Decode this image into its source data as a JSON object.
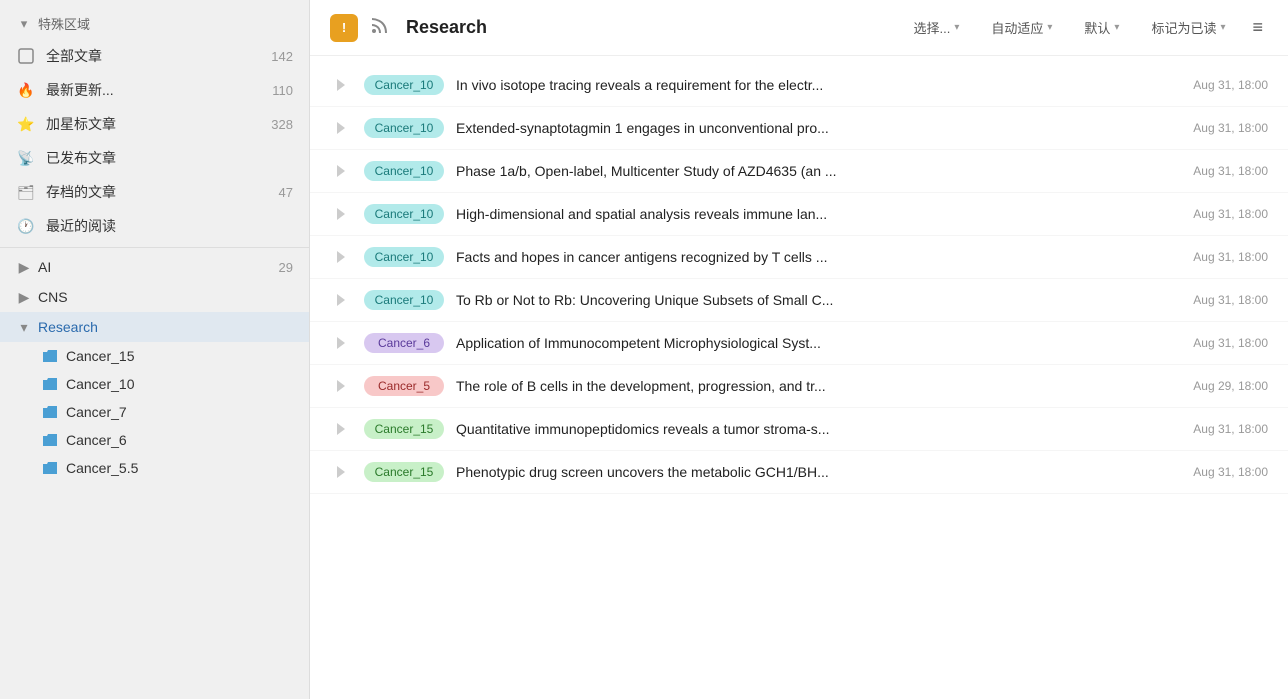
{
  "sidebar": {
    "special_section": "特殊区域",
    "items": [
      {
        "id": "all-articles",
        "label": "全部文章",
        "count": "142",
        "icon": "article"
      },
      {
        "id": "latest",
        "label": "最新更新...",
        "count": "110",
        "icon": "fire"
      },
      {
        "id": "starred",
        "label": "加星标文章",
        "count": "328",
        "icon": "star"
      },
      {
        "id": "published",
        "label": "已发布文章",
        "count": "",
        "icon": "rss"
      },
      {
        "id": "archived",
        "label": "存档的文章",
        "count": "47",
        "icon": "archive"
      },
      {
        "id": "recent",
        "label": "最近的阅读",
        "count": "",
        "icon": "clock"
      }
    ],
    "groups": [
      {
        "id": "ai",
        "label": "AI",
        "count": "29",
        "expanded": false
      },
      {
        "id": "cns",
        "label": "CNS",
        "count": "",
        "expanded": false
      },
      {
        "id": "research",
        "label": "Research",
        "count": "",
        "expanded": true
      }
    ],
    "research_children": [
      {
        "id": "cancer15",
        "label": "Cancer_15"
      },
      {
        "id": "cancer10",
        "label": "Cancer_10"
      },
      {
        "id": "cancer7",
        "label": "Cancer_7"
      },
      {
        "id": "cancer6",
        "label": "Cancer_6"
      },
      {
        "id": "cancer55",
        "label": "Cancer_5.5"
      }
    ]
  },
  "toolbar": {
    "title": "Research",
    "select_label": "选择...",
    "auto_label": "自动适应",
    "default_label": "默认",
    "mark_read_label": "标记为已读"
  },
  "articles": [
    {
      "tag": "Cancer_10",
      "tag_class": "tag-teal",
      "title": "In vivo isotope tracing reveals a requirement for the electr...",
      "date": "Aug 31, 18:00"
    },
    {
      "tag": "Cancer_10",
      "tag_class": "tag-teal",
      "title": "Extended-synaptotagmin 1 engages in unconventional pro...",
      "date": "Aug 31, 18:00"
    },
    {
      "tag": "Cancer_10",
      "tag_class": "tag-teal",
      "title": "Phase 1a/b, Open-label, Multicenter Study of AZD4635 (an ...",
      "date": "Aug 31, 18:00"
    },
    {
      "tag": "Cancer_10",
      "tag_class": "tag-teal",
      "title": "High-dimensional and spatial analysis reveals immune lan...",
      "date": "Aug 31, 18:00"
    },
    {
      "tag": "Cancer_10",
      "tag_class": "tag-teal",
      "title": "Facts and hopes in cancer antigens recognized by T cells ...",
      "date": "Aug 31, 18:00"
    },
    {
      "tag": "Cancer_10",
      "tag_class": "tag-teal",
      "title": "To Rb or Not to Rb: Uncovering Unique Subsets of Small C...",
      "date": "Aug 31, 18:00"
    },
    {
      "tag": "Cancer_6",
      "tag_class": "tag-purple",
      "title": "Application of Immunocompetent Microphysiological Syst...",
      "date": "Aug 31, 18:00"
    },
    {
      "tag": "Cancer_5",
      "tag_class": "tag-pink",
      "title": "The role of B cells in the development, progression, and tr...",
      "date": "Aug 29, 18:00"
    },
    {
      "tag": "Cancer_15",
      "tag_class": "tag-green",
      "title": "Quantitative immunopeptidomics reveals a tumor stroma-s...",
      "date": "Aug 31, 18:00"
    },
    {
      "tag": "Cancer_15",
      "tag_class": "tag-green",
      "title": "Phenotypic drug screen uncovers the metabolic GCH1/BH...",
      "date": "Aug 31, 18:00"
    }
  ]
}
